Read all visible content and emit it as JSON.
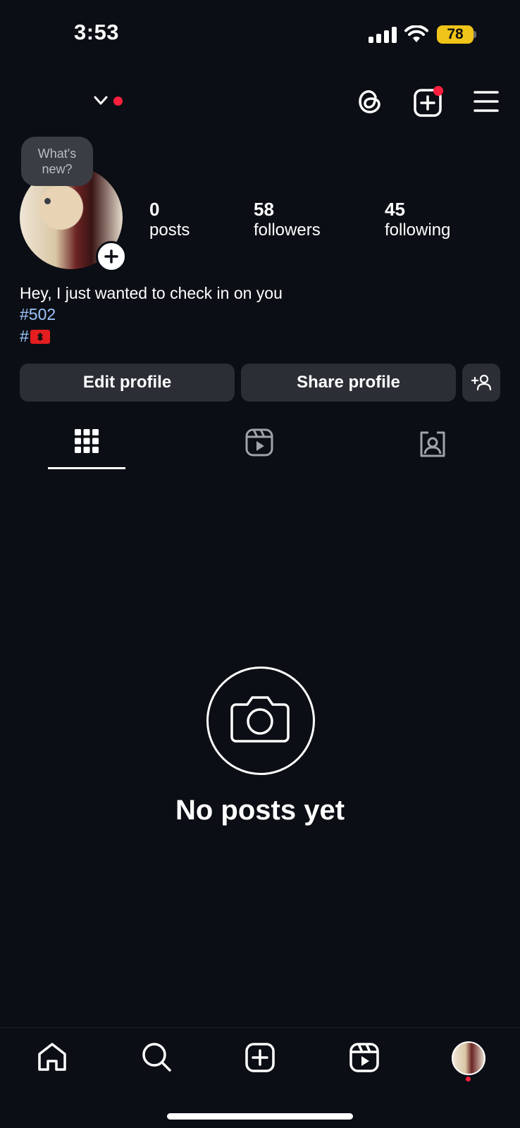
{
  "status_bar": {
    "time": "3:53",
    "battery": "78",
    "battery_color": "#f0c419"
  },
  "header": {
    "icons": [
      "chevron-down-icon",
      "threads-icon",
      "create-icon",
      "menu-icon"
    ],
    "notification_dot_color": "#ff1f3d"
  },
  "profile": {
    "note_bubble": "What's new?",
    "stats": {
      "posts_count": "0",
      "posts_label": "posts",
      "followers_count": "58",
      "followers_label": "followers",
      "following_count": "45",
      "following_label": "following"
    },
    "bio": {
      "line1": "Hey, I just wanted to check in on you",
      "hashtag1": "#502",
      "hashtag2_prefix": "#"
    },
    "buttons": {
      "edit": "Edit profile",
      "share": "Share profile"
    }
  },
  "tabs": [
    "grid-icon",
    "reels-icon",
    "tagged-icon"
  ],
  "empty_state": {
    "title": "No posts yet"
  },
  "bottom_nav": [
    "home-icon",
    "search-icon",
    "create-icon",
    "reels-icon",
    "profile-avatar"
  ],
  "colors": {
    "background": "#0b0e14",
    "button_bg": "#2b2e35",
    "link": "#9ec7ff"
  }
}
